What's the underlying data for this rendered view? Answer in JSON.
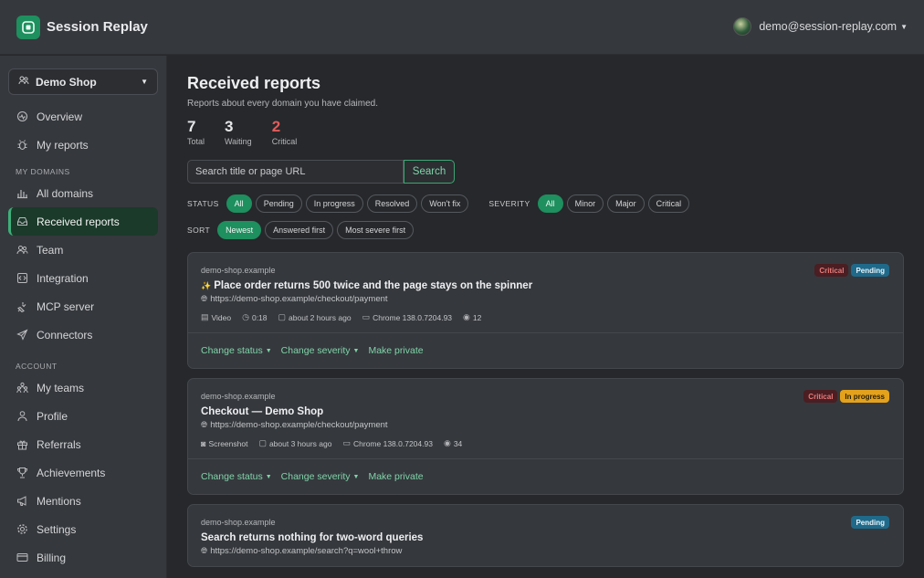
{
  "app": {
    "name": "Session Replay",
    "user_email": "demo@session-replay.com"
  },
  "sidebar": {
    "shop": "Demo Shop",
    "top_items": [
      {
        "label": "Overview",
        "icon": "pulse-icon"
      },
      {
        "label": "My reports",
        "icon": "bug-icon"
      }
    ],
    "section_domains": "MY DOMAINS",
    "domain_items": [
      {
        "label": "All domains",
        "icon": "bar-chart-icon"
      },
      {
        "label": "Received reports",
        "icon": "inbox-icon",
        "active": true
      },
      {
        "label": "Team",
        "icon": "team-icon"
      },
      {
        "label": "Integration",
        "icon": "code-icon"
      },
      {
        "label": "MCP server",
        "icon": "plug-icon"
      },
      {
        "label": "Connectors",
        "icon": "send-icon"
      }
    ],
    "section_account": "ACCOUNT",
    "account_items": [
      {
        "label": "My teams",
        "icon": "teams-icon"
      },
      {
        "label": "Profile",
        "icon": "person-icon"
      },
      {
        "label": "Referrals",
        "icon": "gift-icon"
      },
      {
        "label": "Achievements",
        "icon": "trophy-icon"
      },
      {
        "label": "Mentions",
        "icon": "megaphone-icon"
      },
      {
        "label": "Settings",
        "icon": "gear-icon"
      },
      {
        "label": "Billing",
        "icon": "credit-card-icon"
      }
    ]
  },
  "page": {
    "title": "Received reports",
    "subtitle": "Reports about every domain you have claimed.",
    "stats": [
      {
        "num": "7",
        "label": "Total"
      },
      {
        "num": "3",
        "label": "Waiting"
      },
      {
        "num": "2",
        "label": "Critical"
      }
    ],
    "search": {
      "placeholder": "Search title or page URL",
      "button": "Search"
    },
    "status_label": "STATUS",
    "status_chips": [
      "All",
      "Pending",
      "In progress",
      "Resolved",
      "Won't fix"
    ],
    "severity_label": "SEVERITY",
    "severity_chips": [
      "All",
      "Minor",
      "Major",
      "Critical"
    ],
    "sort_label": "SORT",
    "sort_chips": [
      "Newest",
      "Answered first",
      "Most severe first"
    ]
  },
  "reports": [
    {
      "domain": "demo-shop.example",
      "title": "Place order returns 500 twice and the page stays on the spinner",
      "url": "https://demo-shop.example/checkout/payment",
      "media": "Video",
      "duration": "0:18",
      "time": "about 2 hours ago",
      "browser": "Chrome 138.0.7204.93",
      "views": "12",
      "severity": "Critical",
      "status": "Pending"
    },
    {
      "domain": "demo-shop.example",
      "title": "Checkout — Demo Shop",
      "url": "https://demo-shop.example/checkout/payment",
      "media": "Screenshot",
      "time": "about 3 hours ago",
      "browser": "Chrome 138.0.7204.93",
      "views": "34",
      "severity": "Critical",
      "status": "In progress"
    },
    {
      "domain": "demo-shop.example",
      "title": "Search returns nothing for two-word queries",
      "url": "https://demo-shop.example/search?q=wool+throw",
      "status": "Pending"
    }
  ],
  "actions": {
    "change_status": "Change status",
    "change_severity": "Change severity",
    "make_private": "Make private"
  },
  "colors": {
    "accent": "#1e8f5e",
    "critical": "#e05c5c",
    "in_progress": "#e4a21c",
    "pending": "#1f6a8a"
  }
}
